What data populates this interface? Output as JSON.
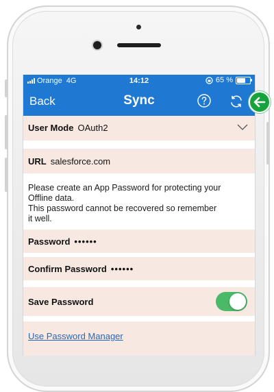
{
  "status_bar": {
    "carrier": "Orange",
    "network": "4G",
    "time": "14:12",
    "battery_text": "65 %",
    "battery_level": 0.65
  },
  "nav": {
    "back_label": "Back",
    "title": "Sync",
    "help_icon": "help-circle-icon",
    "sync_icon": "refresh-icon"
  },
  "form": {
    "user_mode": {
      "label": "User Mode",
      "value": "OAuth2"
    },
    "url": {
      "label": "URL",
      "value": "salesforce.com"
    },
    "note_lines": [
      "Please create an App Password for protecting your",
      "Offline data.",
      "This password cannot be recovered so remember",
      "it well."
    ],
    "password": {
      "label": "Password",
      "value": "••••••"
    },
    "confirm_password": {
      "label": "Confirm Password",
      "value": "••••••"
    },
    "save_password": {
      "label": "Save Password",
      "enabled": true
    },
    "password_manager_link": "Use Password Manager"
  },
  "colors": {
    "nav_bar": "#1f78d1",
    "form_background": "#f7e9e2",
    "toggle_on": "#4ab968",
    "link": "#2a66b3",
    "annotation_arrow": "#17a33b"
  }
}
